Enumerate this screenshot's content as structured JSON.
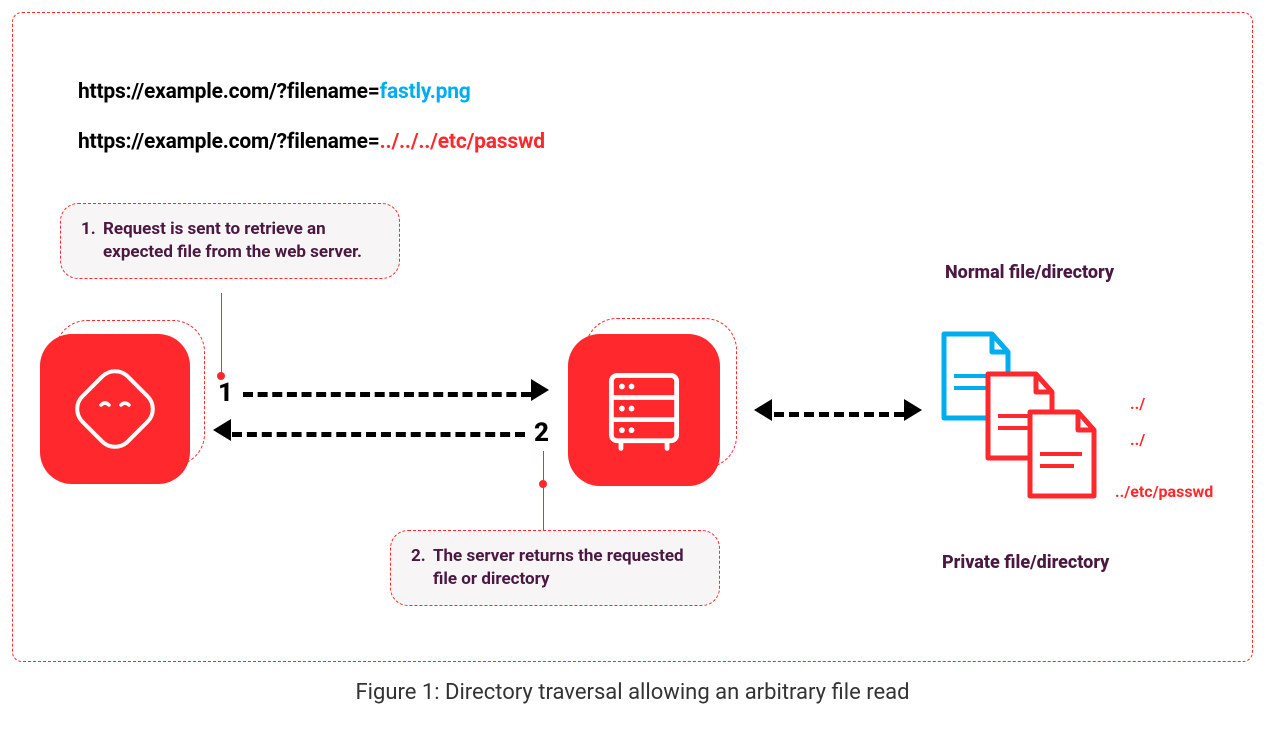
{
  "urls": {
    "base": "https://example.com/?filename=",
    "normal_param": "fastly.png",
    "attack_param": "../../../etc/passwd"
  },
  "steps": {
    "s1_num": "1.",
    "s1_text": "Request is sent to retrieve an expected file from the web server.",
    "s2_num": "2.",
    "s2_text": "The server returns the requested file or directory"
  },
  "markers": {
    "one": "1",
    "two": "2"
  },
  "files": {
    "normal_label": "Normal file/directory",
    "private_label": "Private file/directory",
    "path1": "../",
    "path2": "../",
    "path3": "../etc/passwd"
  },
  "caption": "Figure 1: Directory traversal allowing an arbitrary file read",
  "colors": {
    "accent": "#FF282D",
    "cyan": "#00AEEF",
    "purple": "#4A1840"
  }
}
